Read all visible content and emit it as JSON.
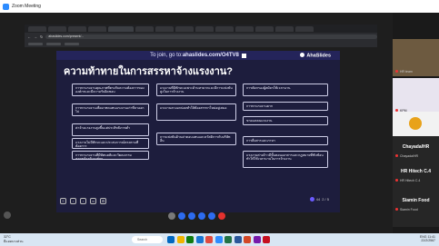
{
  "app_title": "Zoom Meeting",
  "browser": {
    "url": "ahaslides.com/present/..."
  },
  "slide": {
    "join_prefix": "To join, go to: ",
    "join_url": "ahaslides.com/O4TV8",
    "brand": "AhaSlides",
    "title": "ความท้าทายในการสรรหาจ้างแรงงาน?",
    "cards": [
      "การหาแรงงานคุณภาพที่ตรงกับความต้องการขององค์กรและมีความรับผิดชอบ",
      "การหาแรงงานเพื่อมาทดแทนแรงงานเก่าที่ลาออกไป",
      "ค่าจ้างแรงงานสูงขึ้นแต่ประสิทธิภาพต่ำ",
      "แรงงานไม่มีทักษะและประสบการณ์ตรงตามที่ต้องการ",
      "การหาแรงงานที่มีทัศนคติและวัฒนธรรมสอดคล้องกับองค์กร",
      "แรงงานที่มีทักษะเฉพาะด้านหายากและมีการแข่งขันสูงในการจ้างงาน",
      "แรงงานลาออกบ่อยทำให้ต้องสรรหาใหม่อยู่เสมอ",
      "การแข่งขันด้านค่าตอบแทนและสวัสดิการกับบริษัทอื่น",
      "การคัดกรองผู้สมัครใช้เวลานาน",
      "การหาแรงงานยาก",
      "ขาดแคลนแรงงาน",
      "การสื่อสารและภาษา",
      "แรงงานต่างด้าวมีขั้นตอนเอกสารและกฎหมายที่ซับซ้อนทำให้ใช้เวลานานในการจ้างงาน"
    ],
    "response_count": "44",
    "page_counter": "2 / 5"
  },
  "participants": [
    {
      "name": "HR Khon Kaen",
      "caption": "HR team"
    },
    {
      "name": "KPM",
      "caption": "KPM"
    },
    {
      "name": "Chayada/HR",
      "caption": "Chayada/HR"
    },
    {
      "name": "HR Hitech C.4",
      "caption": "HR Hitech C.4"
    },
    {
      "name": "Siamin Food",
      "caption": "Siamin Food"
    }
  ],
  "taskbar": {
    "weather_temp": "32°C",
    "weather_desc": "มีแดดบางส่วน",
    "search_placeholder": "Search",
    "time": "11:41",
    "date": "22/2/2567",
    "language": "ENG"
  },
  "colors": {
    "slide_bg": "#1d1d3d",
    "accent": "#6b5bff",
    "taskbar": "#d8e6f3"
  }
}
